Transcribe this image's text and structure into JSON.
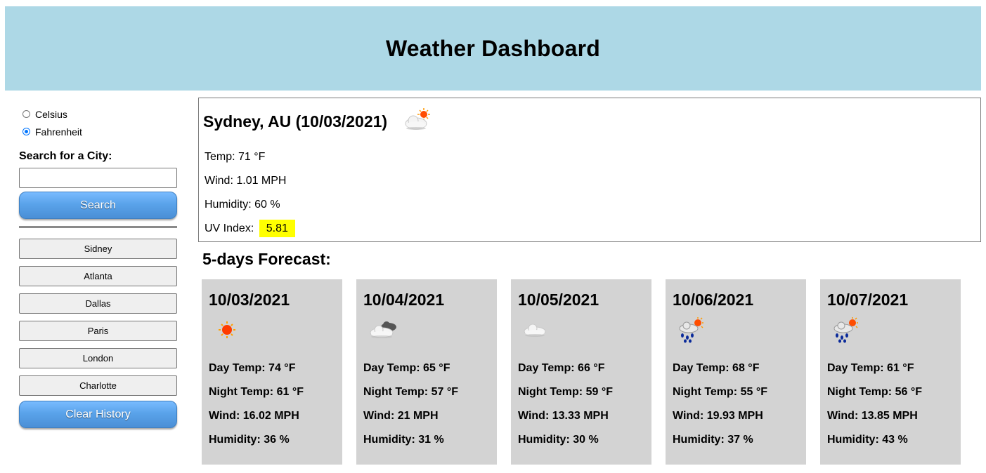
{
  "header": {
    "title": "Weather Dashboard"
  },
  "sidebar": {
    "units": [
      {
        "label": "Celsius",
        "checked": false
      },
      {
        "label": "Fahrenheit",
        "checked": true
      }
    ],
    "search_label": "Search for a City:",
    "search_value": "",
    "search_button": "Search",
    "history": [
      "Sidney",
      "Atlanta",
      "Dallas",
      "Paris",
      "London",
      "Charlotte"
    ],
    "clear_button": "Clear History"
  },
  "current": {
    "title": "Sydney, AU (10/03/2021)",
    "icon": "few-clouds-day-icon",
    "temp": "Temp: 71 °F",
    "wind": "Wind: 1.01 MPH",
    "humidity": "Humidity: 60 %",
    "uv_label": "UV Index:",
    "uv_value": "5.81",
    "uv_color": "#ffff00"
  },
  "forecast": {
    "title": "5-days Forecast:",
    "days": [
      {
        "date": "10/03/2021",
        "icon": "clear-sun-icon",
        "day_temp": "Day Temp: 74 °F",
        "night_temp": "Night Temp: 61 °F",
        "wind": "Wind: 16.02 MPH",
        "humidity": "Humidity: 36 %"
      },
      {
        "date": "10/04/2021",
        "icon": "broken-clouds-icon",
        "day_temp": "Day Temp: 65 °F",
        "night_temp": "Night Temp: 57 °F",
        "wind": "Wind: 21 MPH",
        "humidity": "Humidity: 31 %"
      },
      {
        "date": "10/05/2021",
        "icon": "cloud-icon",
        "day_temp": "Day Temp: 66 °F",
        "night_temp": "Night Temp: 59 °F",
        "wind": "Wind: 13.33 MPH",
        "humidity": "Humidity: 30 %"
      },
      {
        "date": "10/06/2021",
        "icon": "rain-sun-icon",
        "day_temp": "Day Temp: 68 °F",
        "night_temp": "Night Temp: 55 °F",
        "wind": "Wind: 19.93 MPH",
        "humidity": "Humidity: 37 %"
      },
      {
        "date": "10/07/2021",
        "icon": "rain-sun-icon",
        "day_temp": "Day Temp: 61 °F",
        "night_temp": "Night Temp: 56 °F",
        "wind": "Wind: 13.85 MPH",
        "humidity": "Humidity: 43 %"
      }
    ]
  },
  "colors": {
    "header_bg": "#add8e6",
    "card_bg": "#d3d3d3",
    "button_blue": "#5aa3ea"
  }
}
